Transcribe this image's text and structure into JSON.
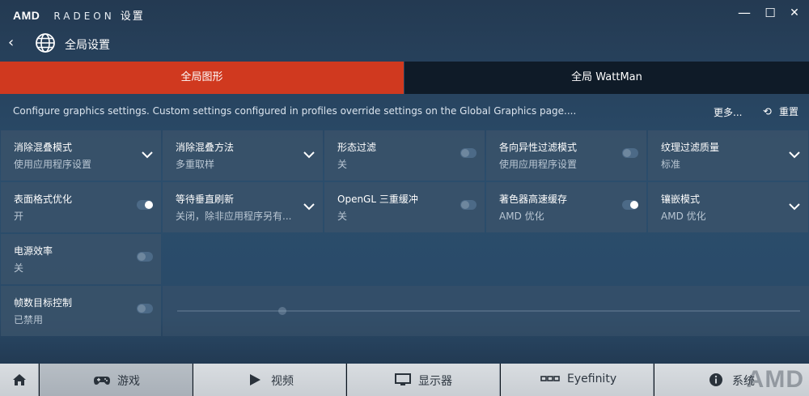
{
  "titlebar": {
    "brand": "AMD",
    "product": "RADEON",
    "section": "设置",
    "minimize": "—",
    "maximize": "☐",
    "close": "✕"
  },
  "header": {
    "back": "‹",
    "title": "全局设置"
  },
  "tabs": [
    {
      "label": "全局图形",
      "active": true
    },
    {
      "label": "全局 WattMan",
      "active": false
    }
  ],
  "info": {
    "text": "Configure graphics settings. Custom settings configured in profiles override settings on the Global Graphics page....",
    "more": "更多...",
    "reset": "重置"
  },
  "settings": [
    {
      "label": "消除混叠模式",
      "value": "使用应用程序设置",
      "control": "dropdown"
    },
    {
      "label": "消除混叠方法",
      "value": "多重取样",
      "control": "dropdown"
    },
    {
      "label": "形态过滤",
      "value": "关",
      "control": "toggle",
      "on": false
    },
    {
      "label": "各向异性过滤模式",
      "value": "使用应用程序设置",
      "control": "toggle",
      "on": false
    },
    {
      "label": "纹理过滤质量",
      "value": "标准",
      "control": "dropdown"
    },
    {
      "label": "表面格式优化",
      "value": "开",
      "control": "toggle",
      "on": true
    },
    {
      "label": "等待垂直刷新",
      "value": "关闭，除非应用程序另有...",
      "control": "dropdown"
    },
    {
      "label": "OpenGL 三重缓冲",
      "value": "关",
      "control": "toggle",
      "on": false
    },
    {
      "label": "著色器高速缓存",
      "value": "AMD 优化",
      "control": "toggle",
      "on": true
    },
    {
      "label": "镶嵌模式",
      "value": "AMD 优化",
      "control": "dropdown"
    },
    {
      "label": "电源效率",
      "value": "关",
      "control": "toggle",
      "on": false
    },
    {
      "label": "帧数目标控制",
      "value": "已禁用",
      "control": "toggle",
      "on": false
    }
  ],
  "nav": {
    "home_icon": "home-icon",
    "items": [
      {
        "label": "游戏",
        "icon": "gamepad-icon",
        "active": true
      },
      {
        "label": "视频",
        "icon": "play-icon",
        "active": false
      },
      {
        "label": "显示器",
        "icon": "monitor-icon",
        "active": false
      },
      {
        "label": "Eyefinity",
        "icon": "eyefinity-icon",
        "active": false
      },
      {
        "label": "系统",
        "icon": "info-icon",
        "active": false
      }
    ],
    "watermark": "AMD"
  },
  "colors": {
    "accent": "#d0391f",
    "tile": "#3a526a",
    "nav_bg": "#c9ced3"
  }
}
